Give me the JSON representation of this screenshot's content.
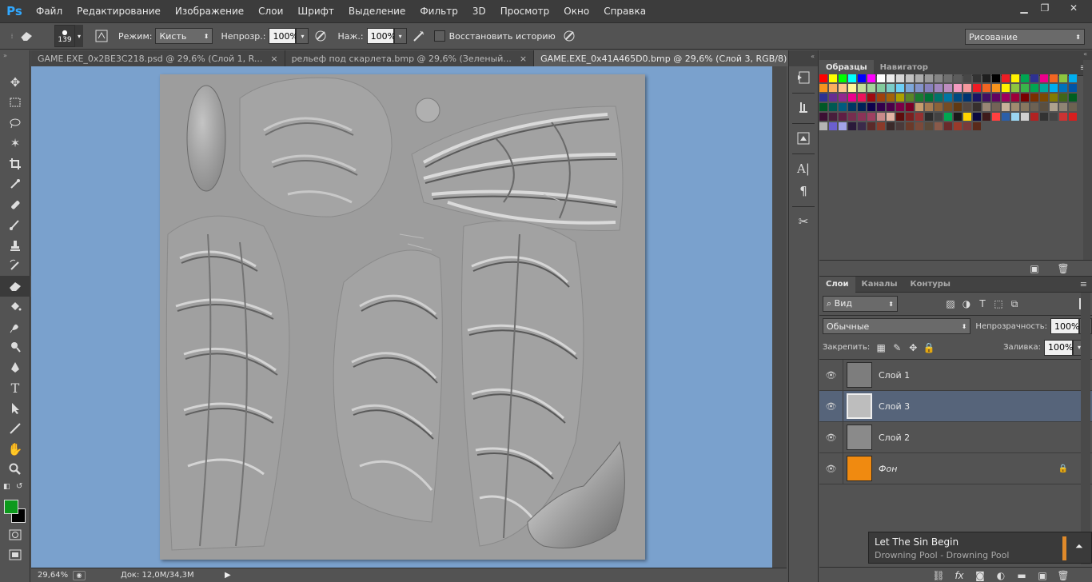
{
  "menubar": {
    "logo": "Ps",
    "items": [
      "Файл",
      "Редактирование",
      "Изображение",
      "Слои",
      "Шрифт",
      "Выделение",
      "Фильтр",
      "3D",
      "Просмотр",
      "Окно",
      "Справка"
    ]
  },
  "options": {
    "brush_size": "139",
    "mode_label": "Режим:",
    "mode_value": "Кисть",
    "opacity_label": "Непрозр.:",
    "opacity_value": "100%",
    "pressure_label": "Наж.:",
    "pressure_value": "100%",
    "restore_history_label": "Восстановить историю",
    "workspace_value": "Рисование"
  },
  "tabs": [
    {
      "label": "GAME.EXE_0x2BE3C218.psd @ 29,6% (Слой 1, R...",
      "close": "×"
    },
    {
      "label": "рельеф под скарлета.bmp @ 29,6% (Зеленый...",
      "close": "×"
    },
    {
      "label": "GAME.EXE_0x41A465D0.bmp @ 29,6% (Слой 3, RGB/8) *",
      "close": "×"
    }
  ],
  "status": {
    "zoom": "29,64%",
    "doc": "Док: 12,0M/34,3M"
  },
  "swatches_panel": {
    "tabs": [
      "Образцы",
      "Навигатор"
    ],
    "colors": [
      "#ff0000",
      "#ffff00",
      "#00ff00",
      "#00ffff",
      "#0000ff",
      "#ff00ff",
      "#ffffff",
      "#ebebeb",
      "#d6d6d6",
      "#c2c2c2",
      "#adadad",
      "#999999",
      "#858585",
      "#707070",
      "#5c5c5c",
      "#474747",
      "#333333",
      "#1f1f1f",
      "#000000",
      "#ed1c24",
      "#fff200",
      "#00a651",
      "#2e3192",
      "#ec008c",
      "#f26522",
      "#8dc63f",
      "#00aeef",
      "#f7941d",
      "#fbaf5d",
      "#fdc689",
      "#fff799",
      "#c4df9b",
      "#a2d39c",
      "#82ca9c",
      "#7accc8",
      "#6dcff6",
      "#7da7d9",
      "#8393ca",
      "#8781bd",
      "#a186be",
      "#bd8cbf",
      "#f49ac1",
      "#f6989d",
      "#ed1c24",
      "#f26522",
      "#f7941d",
      "#fff200",
      "#8dc63f",
      "#39b54a",
      "#00a651",
      "#00a99d",
      "#00aeef",
      "#0072bc",
      "#0054a6",
      "#2e3192",
      "#662d91",
      "#92278f",
      "#ec008c",
      "#ed145b",
      "#9e0b0f",
      "#a0410d",
      "#a36209",
      "#aba000",
      "#598527",
      "#197b30",
      "#007236",
      "#00746b",
      "#0076a3",
      "#004a80",
      "#003471",
      "#1b1464",
      "#440e62",
      "#630460",
      "#9e005d",
      "#9e0039",
      "#790000",
      "#7b2e00",
      "#7d4900",
      "#827b00",
      "#406618",
      "#005e20",
      "#005826",
      "#005952",
      "#005b7f",
      "#003663",
      "#002157",
      "#0d004c",
      "#32004b",
      "#4b0049",
      "#7b0046",
      "#7a0026",
      "#c69c6d",
      "#a67c52",
      "#8c6239",
      "#754c24",
      "#603913",
      "#534741",
      "#362f2d",
      "#998675",
      "#736357",
      "#c7b299",
      "#a08b6f",
      "#87775f",
      "#6d6153",
      "#5a4f40",
      "#aea28e",
      "#8f8474",
      "#6c6251",
      "#3c0f33",
      "#481e3c",
      "#5f1e44",
      "#762d4f",
      "#8a3358",
      "#9e3f61",
      "#c88a8a",
      "#e2b4a4",
      "#5c0d0d",
      "#7a2020",
      "#943131",
      "#2c2c2c",
      "#424242",
      "#00a651",
      "#1a1a1a",
      "#ffd400",
      "#0a0a40",
      "#3d1a1a",
      "#ff4040",
      "#2b5fa8",
      "#9ad5f0",
      "#d0d0d0",
      "#b22222",
      "#333333",
      "#444444",
      "#cc3333",
      "#d71e1e",
      "#b4b4b4",
      "#6b5fcf",
      "#a2a2e8",
      "#2a1a3a",
      "#3a2a4a",
      "#5a2a2a",
      "#8a3a2a",
      "#3a2a2a",
      "#4a3a3a",
      "#6a3a2a",
      "#7a4a3a",
      "#5a4a3a",
      "#8a5a4a",
      "#6a2a2a",
      "#9a3a2a",
      "#7a3a3a",
      "#5a2a1a"
    ]
  },
  "layers_panel": {
    "tabs": [
      "Слои",
      "Каналы",
      "Контуры"
    ],
    "filter_value": "Вид",
    "blend_value": "Обычные",
    "opacity_label": "Непрозрачность:",
    "opacity_value": "100%",
    "lock_label": "Закрепить:",
    "fill_label": "Заливка:",
    "fill_value": "100%",
    "layers": [
      {
        "name": "Слой 1",
        "selected": false,
        "thumb": "#7d7d7d",
        "locked": false
      },
      {
        "name": "Слой 3",
        "selected": true,
        "thumb": "#bdbdbd",
        "locked": false
      },
      {
        "name": "Слой 2",
        "selected": false,
        "thumb": "#8a8a8a",
        "locked": false
      },
      {
        "name": "Фон",
        "selected": false,
        "thumb": "#f08a10",
        "locked": true
      }
    ]
  },
  "notification": {
    "title": "Let The Sin Begin",
    "subtitle": "Drowning Pool - Drowning Pool",
    "accent": "#e08a2a"
  }
}
